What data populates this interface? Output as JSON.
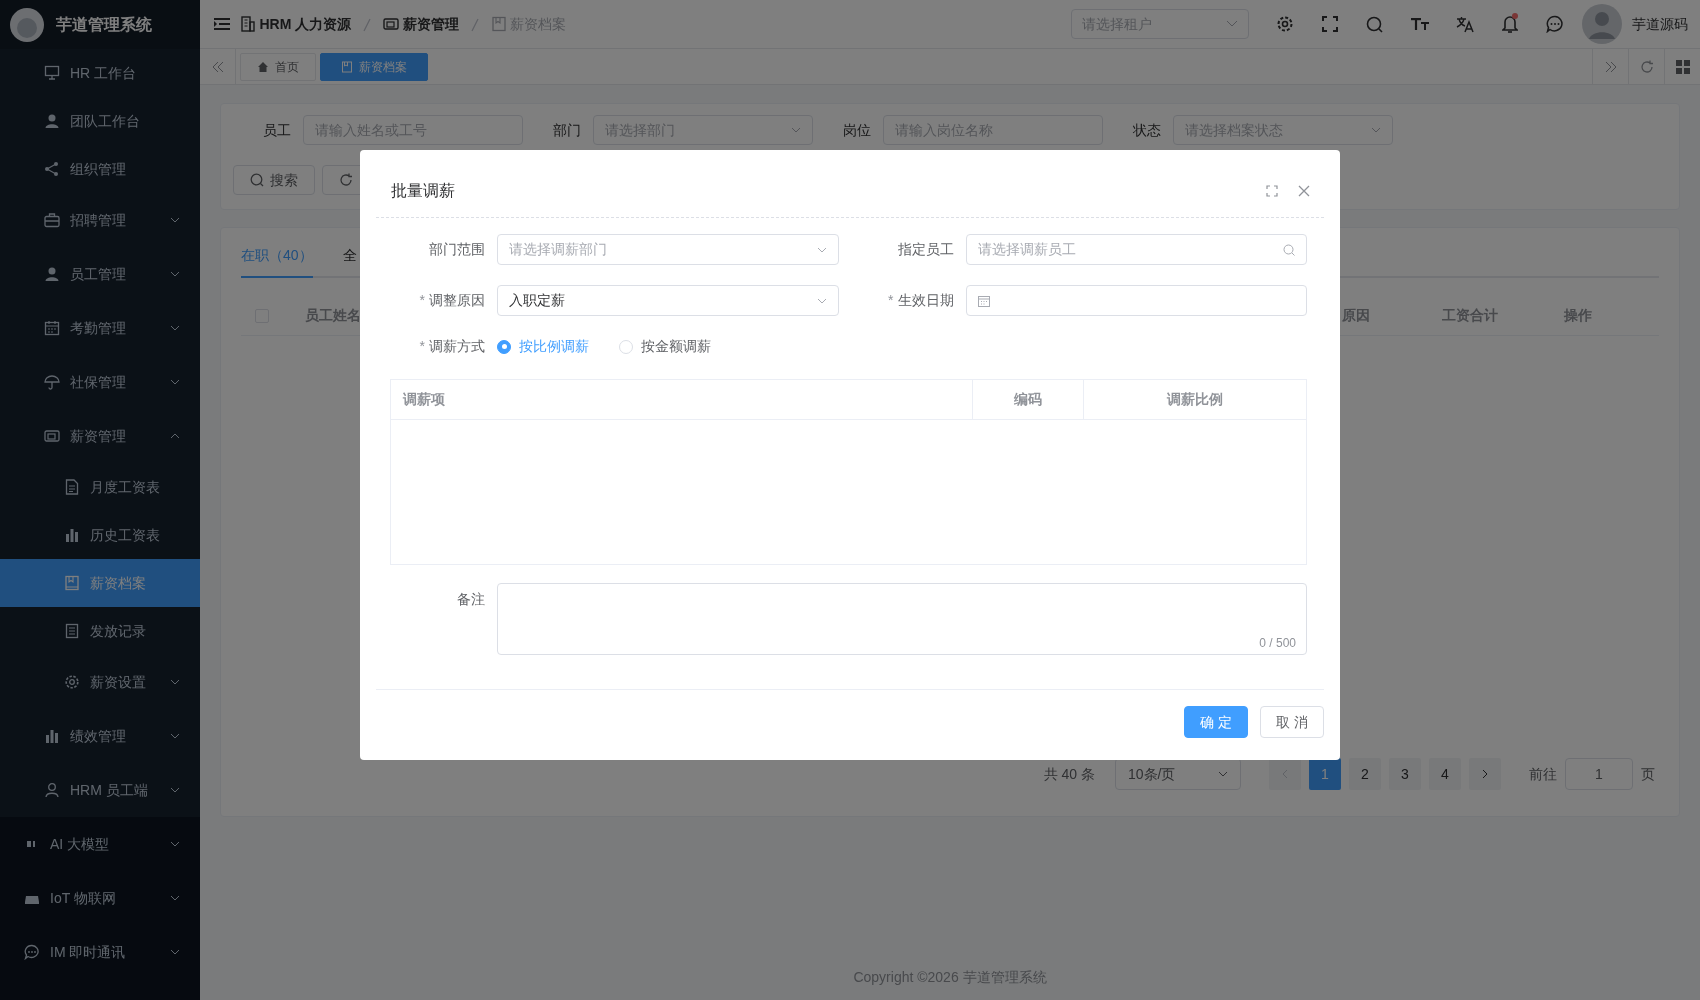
{
  "app": {
    "title": "芋道管理系统"
  },
  "sidebar": {
    "groups": [
      {
        "items": [
          {
            "label": "HR 工作台",
            "kind": "link",
            "selected": false
          },
          {
            "label": "团队工作台",
            "kind": "link",
            "selected": false
          },
          {
            "label": "组织管理",
            "kind": "link",
            "selected": false
          },
          {
            "label": "招聘管理",
            "kind": "submenu",
            "selected": false,
            "expanded": false
          },
          {
            "label": "员工管理",
            "kind": "submenu",
            "selected": false,
            "expanded": false
          },
          {
            "label": "考勤管理",
            "kind": "submenu",
            "selected": false,
            "expanded": false
          },
          {
            "label": "社保管理",
            "kind": "submenu",
            "selected": false,
            "expanded": false
          },
          {
            "label": "薪资管理",
            "kind": "submenu",
            "selected": false,
            "expanded": true,
            "children": [
              {
                "label": "月度工资表",
                "kind": "link",
                "selected": false
              },
              {
                "label": "历史工资表",
                "kind": "link",
                "selected": false
              },
              {
                "label": "薪资档案",
                "kind": "link",
                "selected": true
              },
              {
                "label": "发放记录",
                "kind": "link",
                "selected": false
              },
              {
                "label": "薪资设置",
                "kind": "submenu",
                "selected": false,
                "expanded": false
              }
            ]
          },
          {
            "label": "绩效管理",
            "kind": "submenu",
            "selected": false,
            "expanded": false
          },
          {
            "label": "HRM 员工端",
            "kind": "submenu",
            "selected": false,
            "expanded": false
          }
        ]
      },
      {
        "items": [
          {
            "label": "AI 大模型",
            "kind": "submenu",
            "selected": false,
            "expanded": false
          },
          {
            "label": "IoT 物联网",
            "kind": "submenu",
            "selected": false,
            "expanded": false
          },
          {
            "label": "IM 即时通讯",
            "kind": "submenu",
            "selected": false,
            "expanded": false
          }
        ]
      }
    ]
  },
  "header": {
    "breadcrumb": [
      {
        "label": "HRM 人力资源",
        "current": false
      },
      {
        "label": "薪资管理",
        "current": false
      },
      {
        "label": "薪资档案",
        "current": true
      }
    ],
    "tenant_select": {
      "placeholder": "请选择租户"
    },
    "has_unread": true,
    "user_name": "芋道源码"
  },
  "tags": [
    {
      "label": "首页",
      "selected": false
    },
    {
      "label": "薪资档案",
      "selected": true
    }
  ],
  "search_form": {
    "fields": [
      {
        "label": "员工",
        "placeholder": "请输入姓名或工号",
        "kind": "input"
      },
      {
        "label": "部门",
        "placeholder": "请选择部门",
        "kind": "select"
      },
      {
        "label": "岗位",
        "placeholder": "请输入岗位名称",
        "kind": "input"
      },
      {
        "label": "状态",
        "placeholder": "请选择档案状态",
        "kind": "select"
      }
    ],
    "buttons": [
      {
        "label": "搜索",
        "kind": "search"
      },
      {
        "kind": "reset"
      }
    ]
  },
  "list": {
    "tabs": [
      {
        "label": "在职（40）",
        "selected": true
      },
      {
        "label": "全",
        "selected": false
      }
    ],
    "select_all": {
      "checked": false
    },
    "columns": [
      "员工姓名",
      "原因",
      "工资合计",
      "操作"
    ],
    "pagination": {
      "total": "共 40 条",
      "page_size": "10条/页",
      "pages": [
        {
          "label": "1",
          "selected": true
        },
        {
          "label": "2",
          "selected": false
        },
        {
          "label": "3",
          "selected": false
        },
        {
          "label": "4",
          "selected": false
        }
      ],
      "goto_label": "前往",
      "goto_value": "1",
      "goto_suffix": "页"
    }
  },
  "footer": {
    "copyright": "Copyright ©2026 芋道管理系统"
  },
  "dialog": {
    "title": "批量调薪",
    "fields": [
      {
        "kind": "select",
        "label": "部门范围",
        "placeholder": "请选择调薪部门"
      },
      {
        "kind": "search",
        "label": "指定员工",
        "placeholder": "请选择调薪员工"
      },
      {
        "kind": "select",
        "label": "调整原因",
        "required_mark": "*",
        "value": "入职定薪"
      },
      {
        "kind": "date",
        "label": "生效日期",
        "required_mark": "*"
      }
    ],
    "adjust_mode": {
      "label": "调薪方式",
      "required_mark": "*",
      "options": [
        {
          "label": "按比例调薪",
          "selected": true
        },
        {
          "label": "按金额调薪",
          "selected": false
        }
      ]
    },
    "table": {
      "columns": [
        "调薪项",
        "编码",
        "调薪比例"
      ]
    },
    "remark": {
      "label": "备注",
      "counter": "0 / 500"
    },
    "buttons": [
      {
        "label": "确 定",
        "kind": "primary"
      },
      {
        "label": "取 消",
        "kind": "default"
      }
    ]
  }
}
